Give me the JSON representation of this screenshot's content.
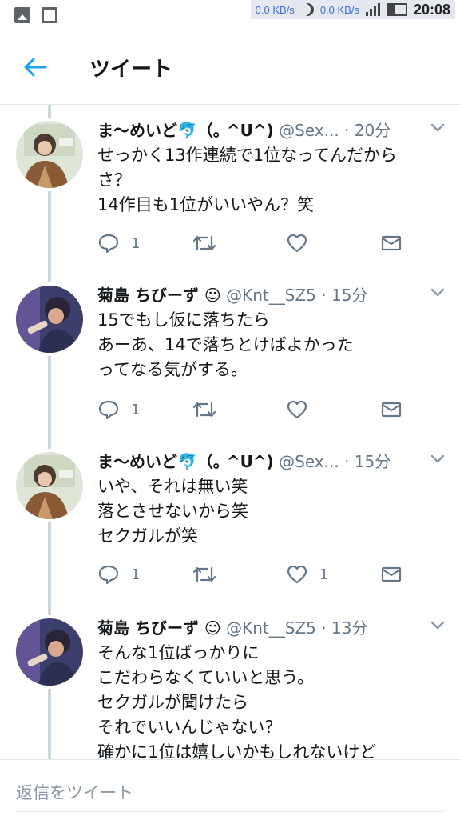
{
  "status_bar": {
    "speed_up": "0.0 KB/s",
    "speed_down": "0.0 KB/s",
    "time": "20:08"
  },
  "header": {
    "title": "ツイート"
  },
  "tweets": [
    {
      "name": "ま〜めいど🐬（｡ ^U^)",
      "handle": "@Sex...",
      "dot": "·",
      "time": "20分",
      "lines": [
        "せっかく13作連続で1位なってんだから",
        "さ？",
        "14作目も1位がいいやん？笑"
      ],
      "reply_count": "1",
      "retweet_count": "",
      "like_count": ""
    },
    {
      "name": "菊島 ちびーず ☺",
      "handle": "@Knt__SZ5",
      "dot": "·",
      "time": "15分",
      "lines": [
        "15でもし仮に落ちたら",
        "あーあ、14で落ちとけばよかった",
        "ってなる気がする。"
      ],
      "reply_count": "1",
      "retweet_count": "",
      "like_count": ""
    },
    {
      "name": "ま〜めいど🐬（｡ ^U^)",
      "handle": "@Sex...",
      "dot": "·",
      "time": "15分",
      "lines": [
        "いや、それは無い笑",
        "落とさせないから笑",
        "セクガルが笑"
      ],
      "reply_count": "1",
      "retweet_count": "",
      "like_count": "1"
    },
    {
      "name": "菊島 ちびーず ☺",
      "handle": "@Knt__SZ5",
      "dot": "·",
      "time": "13分",
      "lines": [
        "そんな1位ばっかりに",
        "こだわらなくていいと思う。",
        "セクガルが聞けたら",
        "それでいいんじゃない？",
        "確かに1位は嬉しいかもしれないけど"
      ],
      "reply_count": "",
      "retweet_count": "",
      "like_count": ""
    }
  ],
  "reply_bar": {
    "placeholder": "返信をツイート"
  },
  "icons": {
    "back": "arrow-left-icon",
    "reply": "speech-bubble-icon",
    "retweet": "retweet-icon",
    "like": "heart-icon",
    "dm": "envelope-icon",
    "caret": "chevron-down-icon"
  },
  "colors": {
    "accent": "#1da1f2",
    "text": "#14171a",
    "muted": "#657786",
    "thread_line": "#ccd6dd"
  }
}
